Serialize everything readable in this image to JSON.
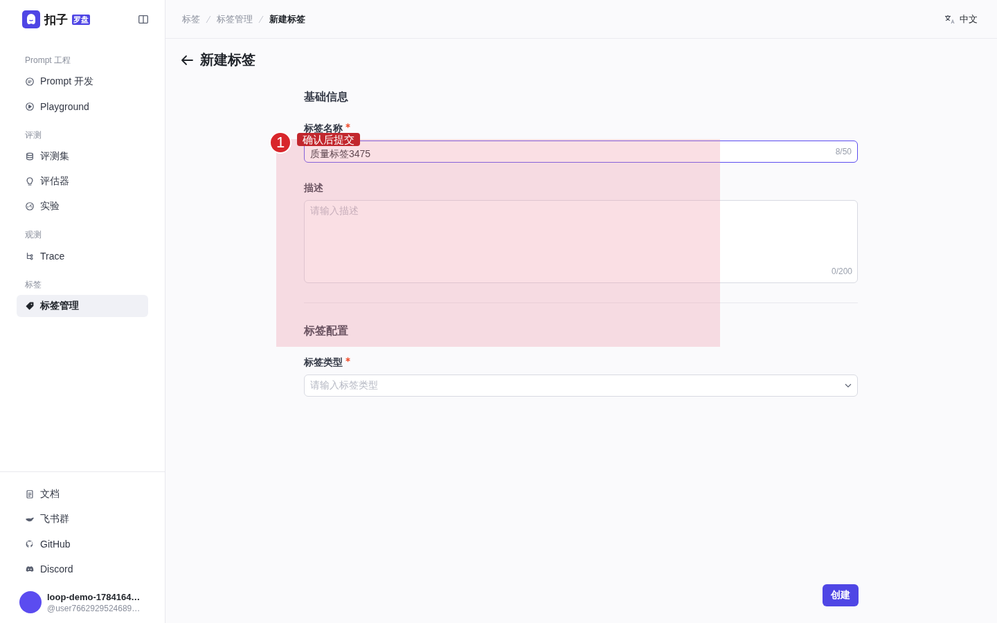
{
  "logo": {
    "name": "扣子",
    "badge": "罗盘"
  },
  "sidebar": {
    "groups": [
      {
        "label": "Prompt 工程",
        "items": [
          {
            "label": "Prompt 开发",
            "selected": false
          },
          {
            "label": "Playground",
            "selected": false
          }
        ]
      },
      {
        "label": "评测",
        "items": [
          {
            "label": "评测集",
            "selected": false
          },
          {
            "label": "评估器",
            "selected": false
          },
          {
            "label": "实验",
            "selected": false
          }
        ]
      },
      {
        "label": "观测",
        "items": [
          {
            "label": "Trace",
            "selected": false
          }
        ]
      },
      {
        "label": "标签",
        "items": [
          {
            "label": "标签管理",
            "selected": true
          }
        ]
      }
    ],
    "footer_items": [
      {
        "label": "文档"
      },
      {
        "label": "飞书群"
      },
      {
        "label": "GitHub"
      },
      {
        "label": "Discord"
      }
    ],
    "user": {
      "name": "loop-demo-1784164…",
      "handle": "@user7662929524689…"
    }
  },
  "breadcrumb": [
    "标签",
    "标签管理",
    "新建标签"
  ],
  "language": "中文",
  "page_title": "新建标签",
  "sections": [
    {
      "title": "基础信息",
      "fields": [
        {
          "kind": "input",
          "label": "标签名称",
          "required": true,
          "value": "质量标签3475",
          "counter": "8/50",
          "focused": true
        },
        {
          "kind": "textarea",
          "label": "描述",
          "placeholder": "请输入描述",
          "counter": "0/200",
          "focused": false
        }
      ]
    },
    {
      "title": "标签配置",
      "fields": [
        {
          "kind": "select",
          "label": "标签类型",
          "required": true,
          "placeholder": "请输入标签类型",
          "focused": false
        }
      ]
    }
  ],
  "submit": "创建",
  "annotation": {
    "number": "1",
    "label": "确认后提交"
  }
}
